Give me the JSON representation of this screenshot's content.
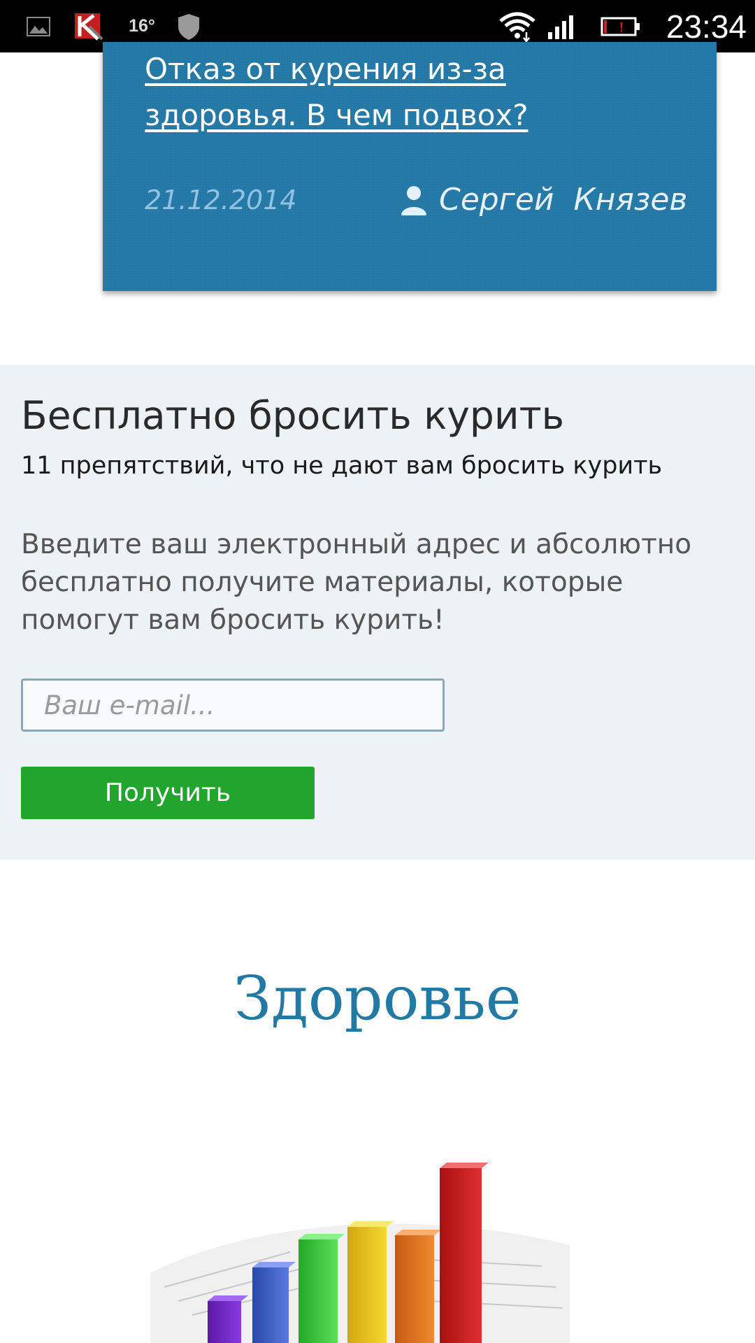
{
  "status_bar": {
    "temperature": "16°",
    "time": "23:34",
    "icons": [
      "gallery-icon",
      "kaspersky-icon",
      "shield-icon",
      "wifi-icon",
      "signal-icon",
      "battery-icon"
    ]
  },
  "article": {
    "title": "Отказ от курения из-за здоровья. В чем подвох?",
    "date": "21.12.2014",
    "author": "Сергей  Князев",
    "card_color": "#2478a6"
  },
  "subscribe": {
    "heading": "Бесплатно бросить курить",
    "subtitle": "11 препятствий, что не дают вам бросить курить",
    "description": "Введите ваш электронный адрес и абсолютно бесплатно получите материалы, которые помогут вам бросить курить!",
    "email_placeholder": "Ваш e-mail...",
    "email_value": "",
    "submit_label": "Получить",
    "button_color": "#22a52c"
  },
  "health_section": {
    "title": "Здоровье",
    "image": "bar-chart-3d-illustration"
  }
}
